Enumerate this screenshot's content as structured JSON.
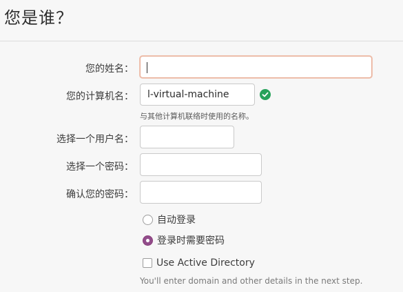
{
  "page": {
    "title": "您是谁？"
  },
  "form": {
    "name_label": "您的姓名：",
    "name_value": "",
    "computer_label": "您的计算机名：",
    "computer_value": "l-virtual-machine",
    "computer_hint": "与其他计算机联络时使用的名称。",
    "username_label": "选择一个用户名：",
    "username_value": "",
    "password_label": "选择一个密码：",
    "password_value": "",
    "confirm_label": "确认您的密码：",
    "confirm_value": ""
  },
  "login_options": {
    "auto_login_label": "自动登录",
    "auto_login_selected": false,
    "require_password_label": "登录时需要密码",
    "require_password_selected": true
  },
  "active_directory": {
    "label": "Use Active Directory",
    "checked": false,
    "note": "You'll enter domain and other details in the next step."
  },
  "colors": {
    "accent": "#924d8b",
    "valid": "#26a25a",
    "focus_border": "#e9b09a"
  }
}
